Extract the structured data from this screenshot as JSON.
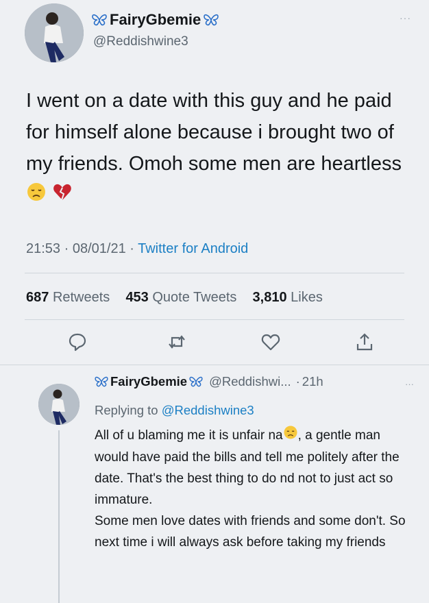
{
  "tweet": {
    "display_name": "FairyGbemie",
    "handle": "@Reddishwine3",
    "more_label": "···",
    "text": "I went on a date with this guy and he paid for himself alone because i brought two of my friends. Omoh some men are heartless",
    "emojis": [
      "sad-face-emoji",
      "broken-heart-emoji"
    ],
    "time": "21:53",
    "date": "08/01/21",
    "source": "Twitter for Android",
    "retweets_count": "687",
    "retweets_label": "Retweets",
    "quotes_count": "453",
    "quotes_label": "Quote Tweets",
    "likes_count": "3,810",
    "likes_label": "Likes",
    "actions": [
      "reply-icon",
      "retweet-icon",
      "like-icon",
      "share-icon"
    ]
  },
  "reply": {
    "display_name": "FairyGbemie",
    "handle": "@Reddishwi...",
    "separator": "·",
    "age": "21h",
    "more_label": "···",
    "replying_prefix": "Replying to",
    "replying_to": "@Reddishwine3",
    "text_line1_a": "All of u blaming me it is unfair na",
    "text_line1_b": ", a gentle man would have paid the bills and tell me politely after the date. That's the best thing to do nd not to just act so immature.",
    "text_line2": "Some men love dates with friends and some don't. So next time i will always ask before taking my friends"
  },
  "colors": {
    "background": "#eef0f3",
    "link": "#1b7fc4",
    "secondary_text": "#5b6670",
    "butterfly": "#2a6fc9"
  }
}
